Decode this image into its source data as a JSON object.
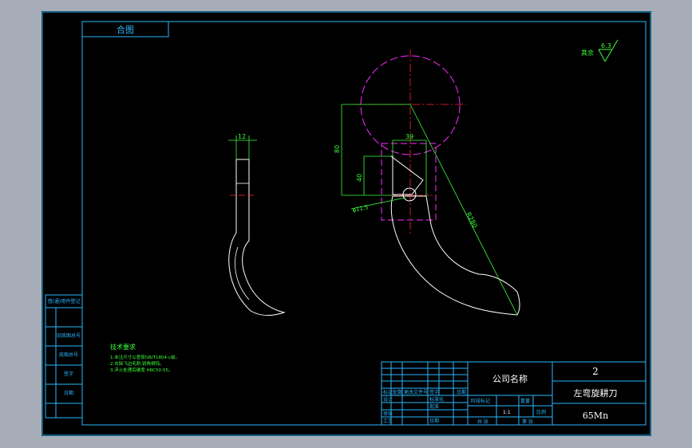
{
  "title_box": {
    "label": "合图"
  },
  "roughness": {
    "label": "其余",
    "value": "6.3"
  },
  "dimensions": {
    "blade_thickness": "12",
    "hole_offset": "39",
    "height_upper": "80",
    "height_lower": "40",
    "hole_diameter": "φ11.5",
    "radius": "R280"
  },
  "technical_requirements": {
    "heading": "技术要求",
    "lines": [
      "1.未注尺寸公差按GB/T1804-c级。",
      "2.去除飞边毛刺,锐角倒钝。",
      "3.淬火处理后硬度 HRC50-55。"
    ]
  },
  "left_column": [
    "借(通)用件登记",
    "",
    "旧底图总号",
    "底图总号",
    "签字",
    "日期"
  ],
  "title_block": {
    "company": "公司名称",
    "quantity": "2",
    "part_name": "左弯旋耕刀",
    "material": "65Mn",
    "row_labels": [
      "标记",
      "处数",
      "更改文件号",
      "签字",
      "日期"
    ],
    "design": "设计",
    "check": "审核",
    "process": "工艺",
    "standard": "标准化",
    "approve": "批准",
    "date": "日期",
    "stage": "阶段标记",
    "weight": "重量",
    "scale": "比例",
    "scale_value": "1:1",
    "sheets": "共 张",
    "sheet_no": "第 张"
  },
  "colors": {
    "frame": "#2ab8ff",
    "outline": "#ffffff",
    "dimension": "#3cff3c",
    "center_line": "#ff2a2a",
    "hidden_line": "#ff2aff"
  }
}
